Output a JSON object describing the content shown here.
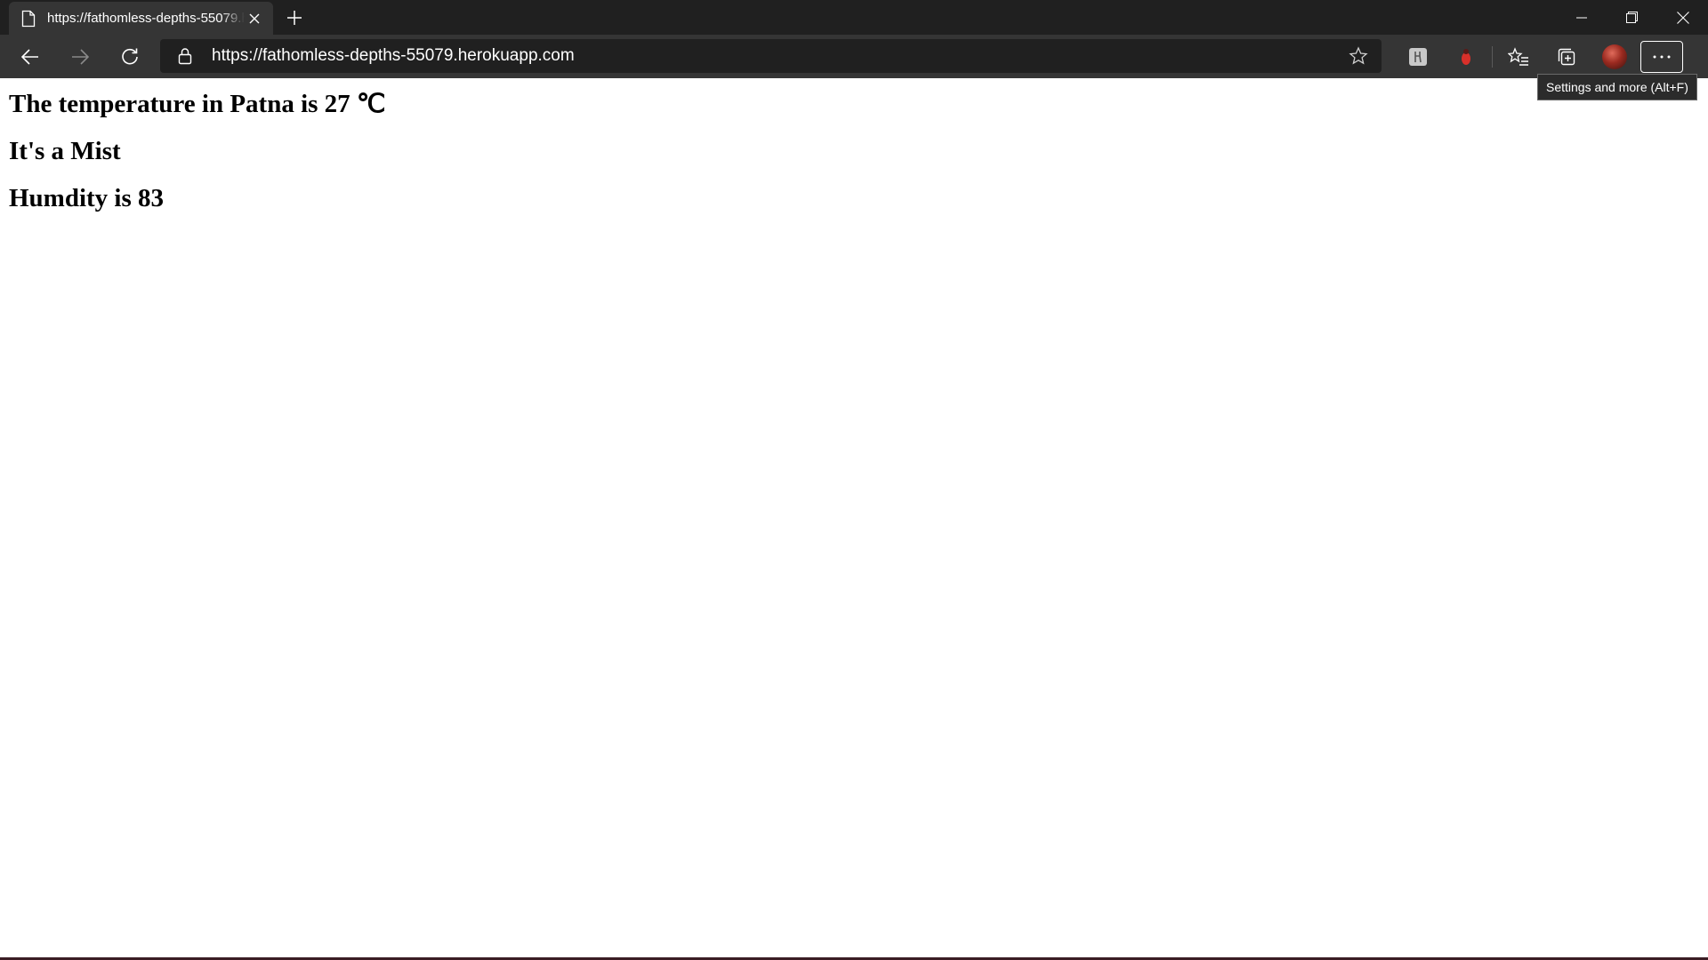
{
  "browser": {
    "tab": {
      "title": "https://fathomless-depths-55079.herokuapp.com/",
      "close_icon": "close-icon",
      "page_icon": "document-icon"
    },
    "new_tab_icon": "plus-icon",
    "window_controls": [
      "minimize-icon",
      "restore-icon",
      "close-icon"
    ],
    "toolbar": {
      "back_icon": "arrow-left-icon",
      "forward_icon": "arrow-right-icon",
      "refresh_icon": "refresh-icon",
      "address_url": "https://fathomless-depths-55079.herokuapp.com",
      "lock_icon": "lock-icon",
      "favorite_icon": "star-icon",
      "extensions": [
        "extension-icon",
        "ladybug-extension-icon"
      ],
      "favorites_icon": "favorites-icon",
      "collections_icon": "collections-icon",
      "profile_icon": "avatar",
      "more_icon": "ellipsis-icon"
    },
    "tooltip": "Settings and more (Alt+F)"
  },
  "page": {
    "temperature_line": "The temperature in Patna is 27 ℃",
    "condition_line": "It's a Mist",
    "humidity_line": "Humdity is 83"
  },
  "colors": {
    "titlebar_bg": "#202020",
    "toolbar_bg": "#353535",
    "address_bg": "#202020",
    "page_bg": "#ffffff"
  }
}
